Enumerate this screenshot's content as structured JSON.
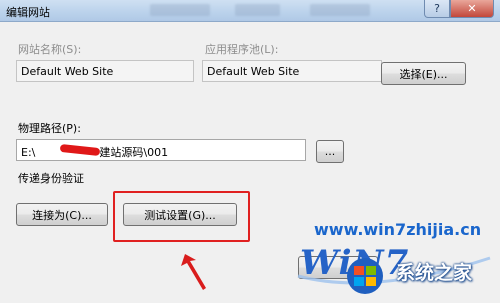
{
  "window": {
    "title": "编辑网站",
    "minimize_icon": "minimize-icon",
    "close_icon": "close-icon"
  },
  "site": {
    "name_label": "网站名称(S):",
    "name_value": "Default Web Site",
    "pool_label": "应用程序池(L):",
    "pool_value": "Default Web Site",
    "select_button": "选择(E)..."
  },
  "path": {
    "label": "物理路径(P):",
    "prefix": "E:\\",
    "suffix": "建站源码\\001",
    "browse_button": "..."
  },
  "auth": {
    "label": "传递身份验证",
    "connect_button": "连接为(C)...",
    "test_button": "测试设置(G)..."
  },
  "watermark": {
    "url": "www.win7zhijia.cn",
    "logo": "WiN7",
    "cn": "系统之家"
  },
  "colors": {
    "highlight": "#e02020",
    "watermark_blue": "#1a66cc"
  }
}
